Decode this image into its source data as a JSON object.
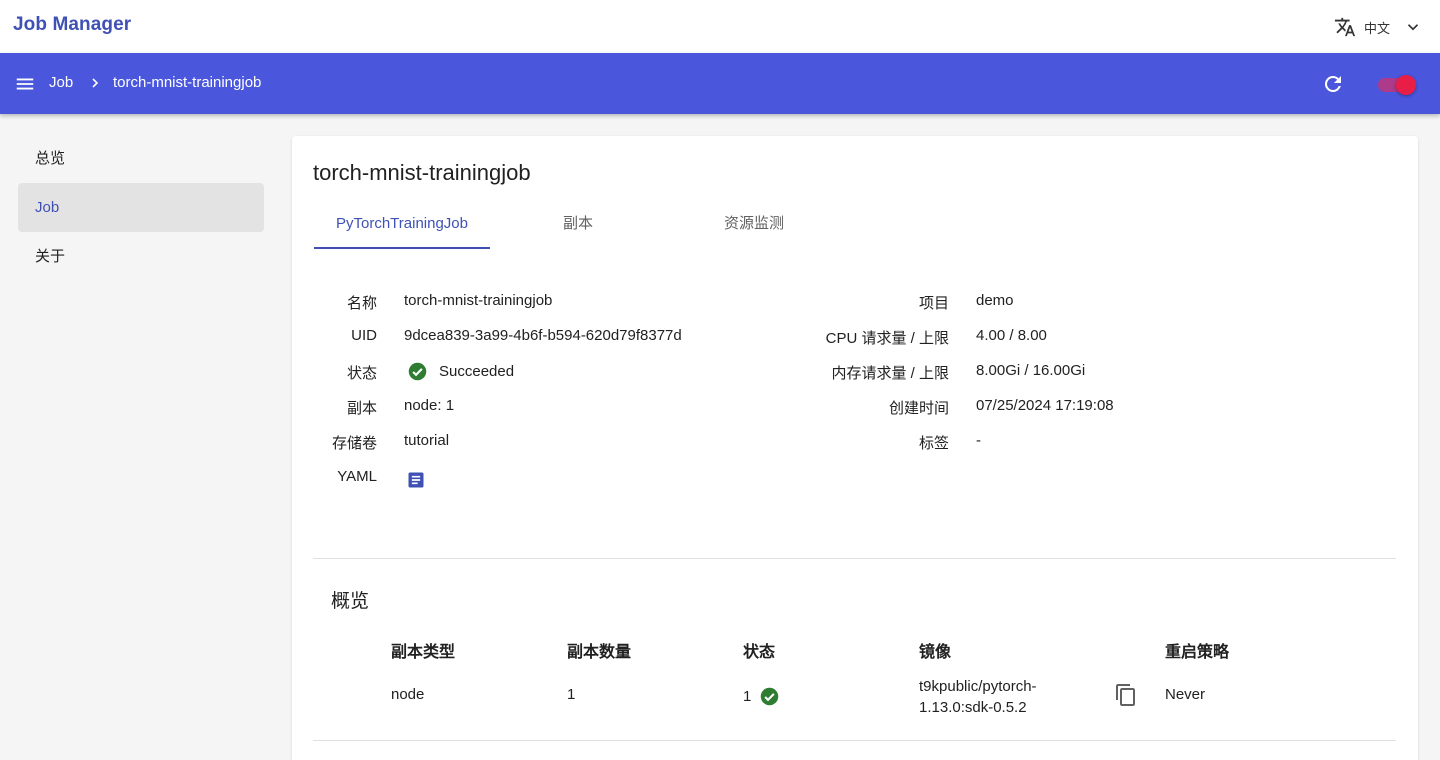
{
  "app": {
    "title": "Job Manager"
  },
  "language": {
    "label": "中文",
    "icon": "translate-icon",
    "dropdown_icon": "chevron-down-icon"
  },
  "navbar": {
    "menu_icon": "menu-icon",
    "breadcrumb_root": "Job",
    "breadcrumb_current": "torch-mnist-trainingjob",
    "refresh_icon": "refresh-icon",
    "toggle_on": true,
    "bg_color": "#4a56dc"
  },
  "sidebar": {
    "items": [
      {
        "label": "总览",
        "active": false
      },
      {
        "label": "Job",
        "active": true
      },
      {
        "label": "关于",
        "active": false
      }
    ]
  },
  "job": {
    "title": "torch-mnist-trainingjob",
    "tabs": [
      {
        "label": "PyTorchTrainingJob",
        "active": true
      },
      {
        "label": "副本",
        "active": false
      },
      {
        "label": "资源监测",
        "active": false
      }
    ],
    "details_left": [
      {
        "label": "名称",
        "value": "torch-mnist-trainingjob"
      },
      {
        "label": "UID",
        "value": "9dcea839-3a99-4b6f-b594-620d79f8377d"
      },
      {
        "label": "状态",
        "value": "Succeeded",
        "icon": "check-circle-icon"
      },
      {
        "label": "副本",
        "value": "node: 1"
      },
      {
        "label": "存储卷",
        "value": "tutorial"
      },
      {
        "label": "YAML",
        "icon": "document-icon"
      }
    ],
    "details_right": [
      {
        "label": "项目",
        "value": "demo"
      },
      {
        "label": "CPU 请求量 / 上限",
        "value": "4.00 / 8.00"
      },
      {
        "label": "内存请求量 / 上限",
        "value": "8.00Gi / 16.00Gi"
      },
      {
        "label": "创建时间",
        "value": "07/25/2024 17:19:08"
      },
      {
        "label": "标签",
        "value": "-"
      }
    ],
    "overview": {
      "title": "概览",
      "headers": [
        "副本类型",
        "副本数量",
        "状态",
        "镜像",
        "重启策略"
      ],
      "rows": [
        {
          "type": "node",
          "count": "1",
          "status": "1",
          "status_icon": "check-circle-icon",
          "image_line1": "t9kpublic/pytorch-",
          "image_line2": "1.13.0:sdk-0.5.2",
          "copy_icon": "copy-icon",
          "restart_policy": "Never"
        }
      ]
    },
    "colors": {
      "accent": "#3f51b5",
      "success": "#2e7d32",
      "toggle": "#e91e47"
    }
  }
}
